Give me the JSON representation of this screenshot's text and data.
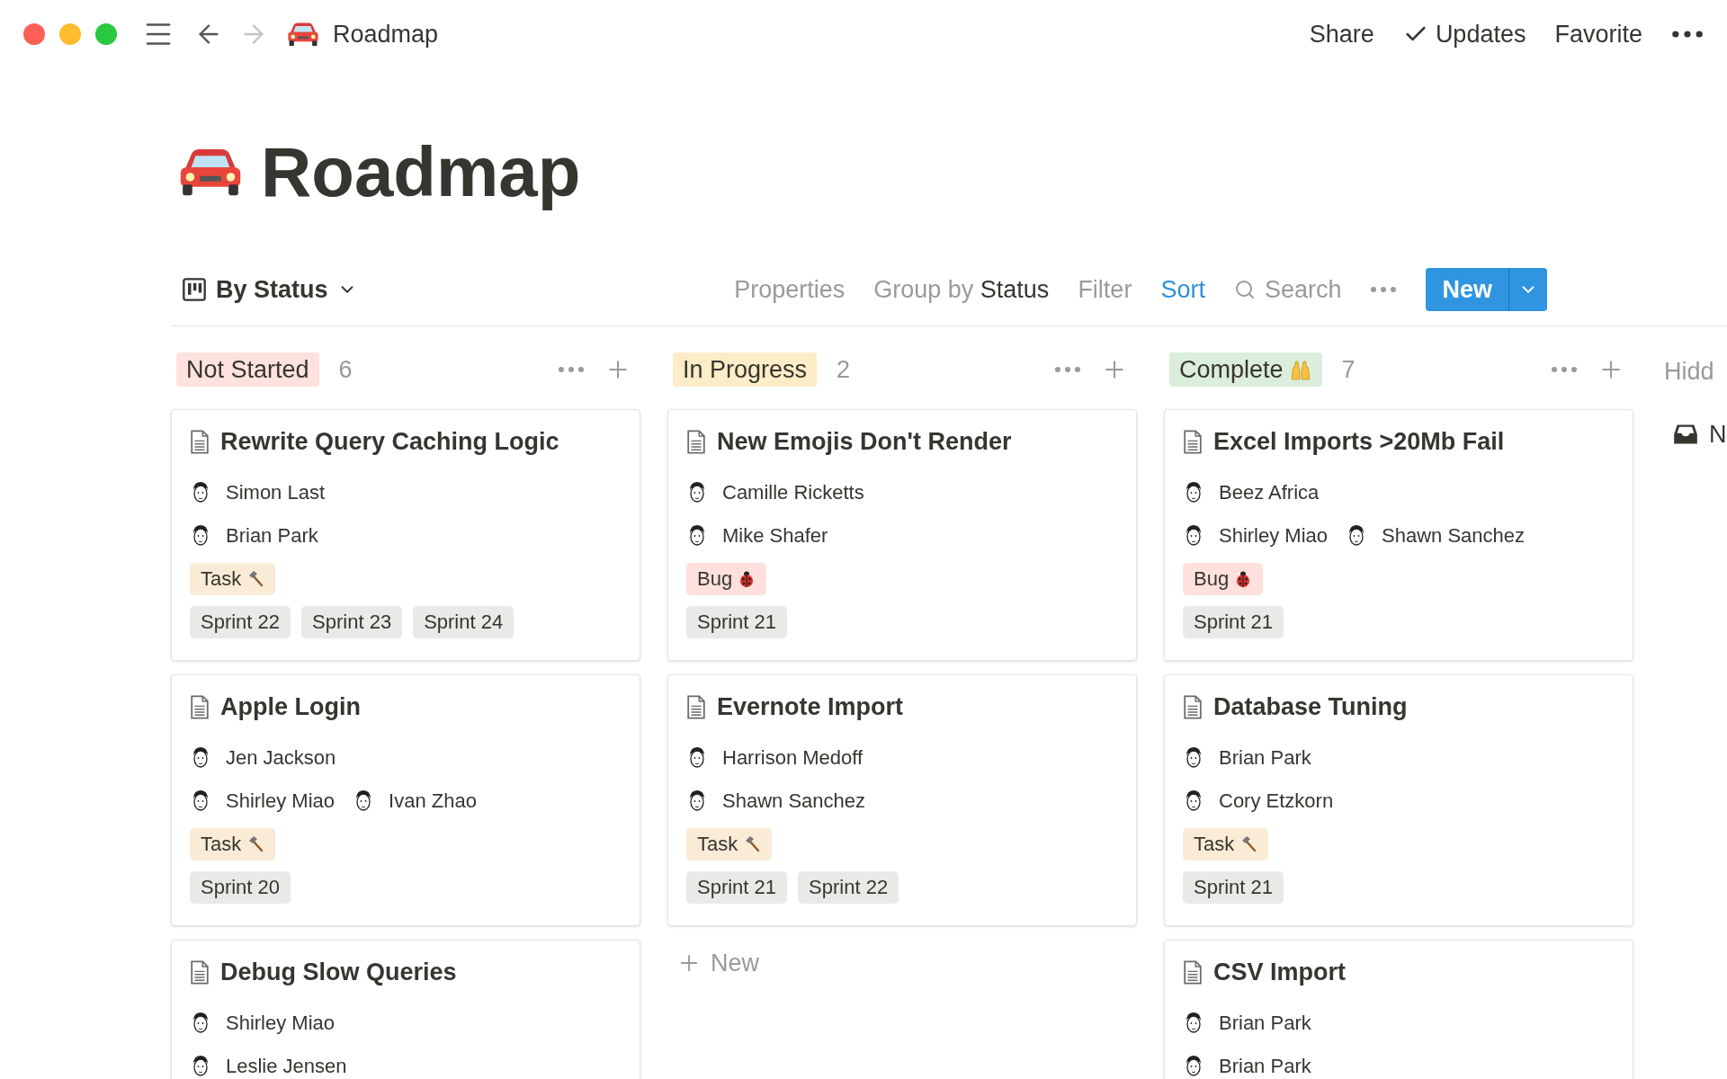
{
  "topbar": {
    "title": "Roadmap",
    "back_disabled": false,
    "forward_disabled": true,
    "actions": [
      {
        "label": "Share",
        "kind": "plain"
      },
      {
        "label": "Updates",
        "kind": "check"
      },
      {
        "label": "Favorite",
        "kind": "plain"
      }
    ]
  },
  "page": {
    "title": "Roadmap"
  },
  "toolbar": {
    "view": "By Status",
    "items": [
      {
        "label": "Properties",
        "kind": "plain",
        "active": false
      },
      {
        "label": "Group by",
        "value": "Status",
        "kind": "group",
        "active": false
      },
      {
        "label": "Filter",
        "kind": "plain",
        "active": false
      },
      {
        "label": "Sort",
        "kind": "plain",
        "active": true
      },
      {
        "label": "Search",
        "kind": "search",
        "active": false
      }
    ],
    "new_button": "New"
  },
  "groups": [
    {
      "name": "Not Started",
      "count": "6",
      "color": "#ffe2dd",
      "kind": "plain",
      "cards": [
        {
          "title": "Rewrite Query Caching Logic",
          "people": [
            [
              "Simon Last"
            ],
            [
              "Brian Park"
            ]
          ],
          "type": {
            "label": "Task",
            "kind": "task"
          },
          "sprints": [
            "Sprint 22",
            "Sprint 23",
            "Sprint 24"
          ]
        },
        {
          "title": "Apple Login",
          "people": [
            [
              "Jen Jackson"
            ],
            [
              "Shirley Miao",
              "Ivan Zhao"
            ]
          ],
          "type": {
            "label": "Task",
            "kind": "task"
          },
          "sprints": [
            "Sprint 20"
          ]
        },
        {
          "title": "Debug Slow Queries",
          "people": [
            [
              "Shirley Miao"
            ],
            [
              "Leslie Jensen"
            ]
          ]
        }
      ]
    },
    {
      "name": "In Progress",
      "count": "2",
      "color": "#fdecc8",
      "kind": "plain",
      "new_label": "New",
      "cards": [
        {
          "title": "New Emojis Don't Render",
          "people": [
            [
              "Camille Ricketts"
            ],
            [
              "Mike Shafer"
            ]
          ],
          "type": {
            "label": "Bug",
            "kind": "bug"
          },
          "sprints": [
            "Sprint 21"
          ]
        },
        {
          "title": "Evernote Import",
          "people": [
            [
              "Harrison Medoff"
            ],
            [
              "Shawn Sanchez"
            ]
          ],
          "type": {
            "label": "Task",
            "kind": "task"
          },
          "sprints": [
            "Sprint 21",
            "Sprint 22"
          ]
        }
      ]
    },
    {
      "name": "Complete",
      "count": "7",
      "color": "#dbeddb",
      "kind": "celebrated",
      "cards": [
        {
          "title": "Excel Imports >20Mb Fail",
          "people": [
            [
              "Beez Africa"
            ],
            [
              "Shirley Miao",
              "Shawn Sanchez"
            ]
          ],
          "type": {
            "label": "Bug",
            "kind": "bug"
          },
          "sprints": [
            "Sprint 21"
          ]
        },
        {
          "title": "Database Tuning",
          "people": [
            [
              "Brian Park"
            ],
            [
              "Cory Etzkorn"
            ]
          ],
          "type": {
            "label": "Task",
            "kind": "task"
          },
          "sprints": [
            "Sprint 21"
          ]
        },
        {
          "title": "CSV Import",
          "people": [
            [
              "Brian Park"
            ],
            [
              "Brian Park"
            ]
          ]
        }
      ]
    }
  ],
  "hidden": {
    "title": "Hidd",
    "item": "N"
  }
}
